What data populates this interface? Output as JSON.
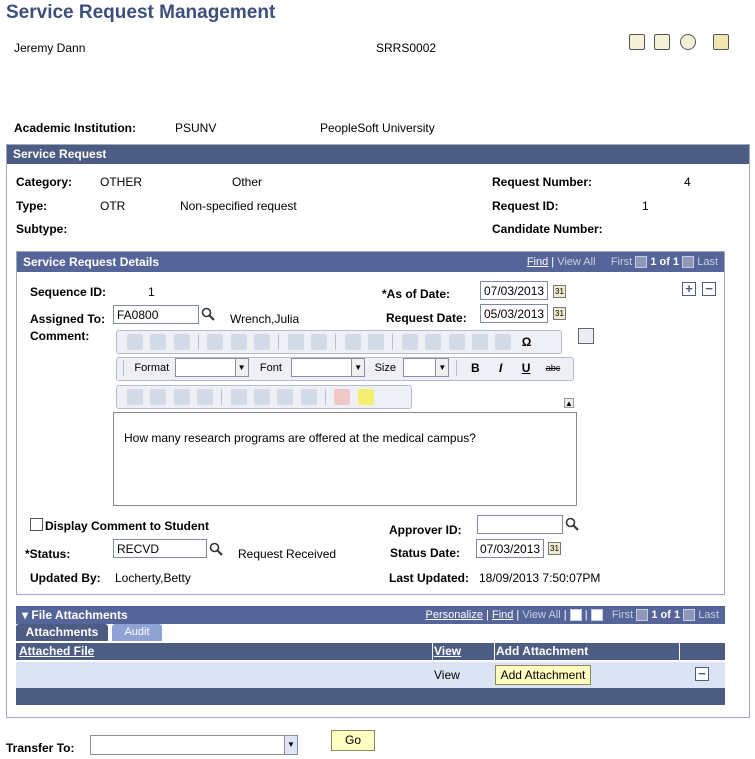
{
  "page": {
    "title": "Service Request Management"
  },
  "header": {
    "name": "Jeremy Dann",
    "id": "SRRS0002"
  },
  "top_icons": [
    "notify-icon",
    "worklist-icon",
    "help-icon",
    "personalize-page-icon"
  ],
  "institution": {
    "label": "Academic Institution:",
    "code": "PSUNV",
    "name": "PeopleSoft University"
  },
  "service_request": {
    "header": "Service Request",
    "category_label": "Category:",
    "category_code": "OTHER",
    "category_desc": "Other",
    "type_label": "Type:",
    "type_code": "OTR",
    "type_desc": "Non-specified request",
    "subtype_label": "Subtype:",
    "request_number_label": "Request Number:",
    "request_number": "4",
    "request_id_label": "Request ID:",
    "request_id": "1",
    "candidate_number_label": "Candidate Number:"
  },
  "details": {
    "header": "Service Request Details",
    "nav": {
      "find": "Find",
      "view_all": "View All",
      "first": "First",
      "count": "1 of 1",
      "last": "Last"
    },
    "sequence_label": "Sequence ID:",
    "sequence": "1",
    "as_of_label": "*As of Date:",
    "as_of": "07/03/2013",
    "assigned_label": "Assigned To:",
    "assigned": "FA0800",
    "assigned_name": "Wrench,Julia",
    "request_date_label": "Request Date:",
    "request_date": "05/03/2013",
    "comment_label": "Comment:",
    "toolbar": {
      "format": "Format",
      "font": "Font",
      "size": "Size",
      "bold": "B",
      "italic": "I",
      "underline": "U",
      "strike": "abc",
      "special_char": "Ω"
    },
    "comment_text": "How many research programs are offered at the medical campus?",
    "display_label": "Display Comment to Student",
    "approver_label": "Approver ID:",
    "status_label": "*Status:",
    "status": "RECVD",
    "status_desc": "Request Received",
    "status_date_label": "Status Date:",
    "status_date": "07/03/2013",
    "updated_by_label": "Updated By:",
    "updated_by": "Locherty,Betty",
    "last_updated_label": "Last Updated:",
    "last_updated": "18/09/2013  7:50:07PM",
    "add_row": "+",
    "delete_row": "−"
  },
  "attachments": {
    "header": "File Attachments",
    "nav": {
      "personalize": "Personalize",
      "find": "Find",
      "view_all": "View All",
      "first": "First",
      "count": "1 of 1",
      "last": "Last"
    },
    "tabs": [
      "Attachments",
      "Audit"
    ],
    "columns": [
      "Attached File",
      "View",
      "Add Attachment"
    ],
    "row": {
      "view": "View",
      "add_button": "Add Attachment",
      "delete": "−"
    }
  },
  "footer": {
    "transfer_label": "Transfer To:",
    "go": "Go"
  }
}
